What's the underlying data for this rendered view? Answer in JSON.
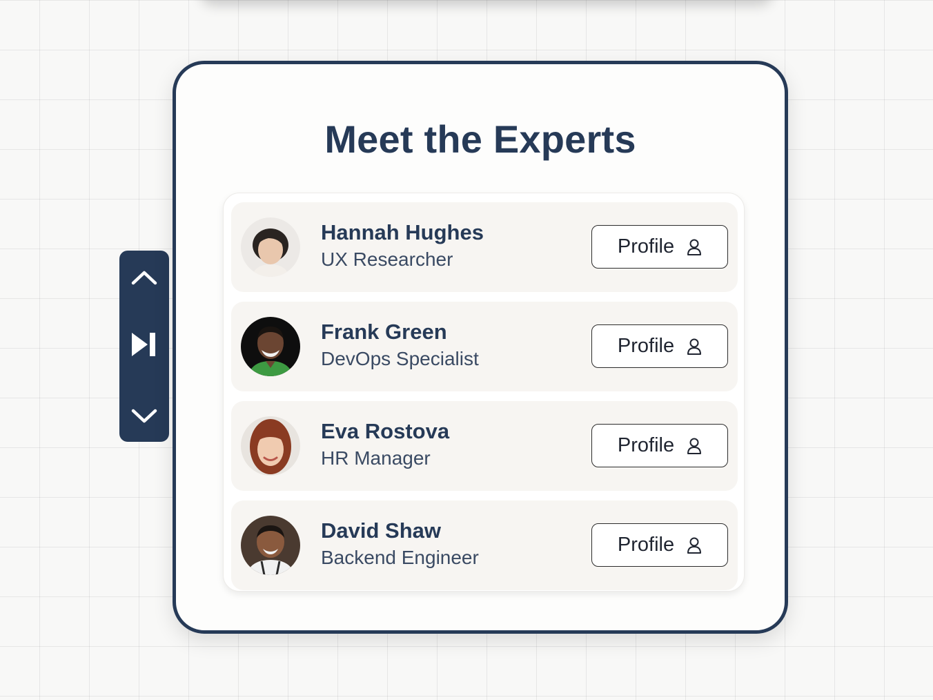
{
  "title": "Meet the Experts",
  "experts": [
    {
      "name": "Hannah Hughes",
      "role": "UX Researcher",
      "button_label": "Profile",
      "avatar_icon": "avatar-hannah"
    },
    {
      "name": "Frank Green",
      "role": "DevOps Specialist",
      "button_label": "Profile",
      "avatar_icon": "avatar-frank"
    },
    {
      "name": "Eva Rostova",
      "role": "HR Manager",
      "button_label": "Profile",
      "avatar_icon": "avatar-eva"
    },
    {
      "name": "David Shaw",
      "role": "Backend Engineer",
      "button_label": "Profile",
      "avatar_icon": "avatar-david"
    }
  ],
  "side_nav": {
    "items": [
      "chevron-up-icon",
      "skip-next-icon",
      "chevron-down-icon"
    ]
  },
  "colors": {
    "primary": "#263a57",
    "row_background": "#f7f5f2",
    "card_background": "#fdfdfc"
  }
}
